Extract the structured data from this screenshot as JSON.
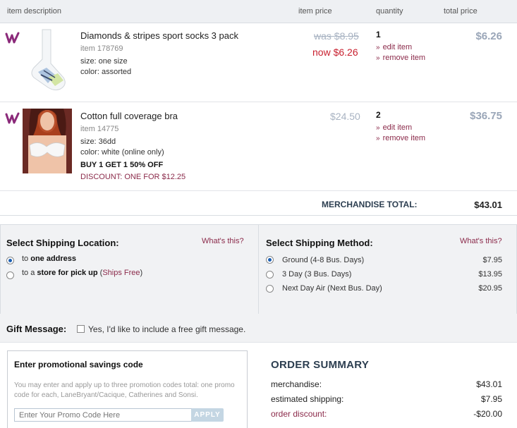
{
  "table_header": {
    "description": "item description",
    "price": "item price",
    "quantity": "quantity",
    "total": "total price"
  },
  "items": [
    {
      "name": "Diamonds & stripes sport socks 3 pack",
      "item_no": "item 178769",
      "size": "size: one size",
      "color": "color: assorted",
      "was": "was $8.95",
      "now": "now $6.26",
      "qty": "1",
      "edit": "edit item",
      "remove": "remove item",
      "total": "$6.26"
    },
    {
      "name": "Cotton full coverage bra",
      "item_no": "item 14775",
      "size": "size: 36dd",
      "color": "color: white (online only)",
      "offer": "BUY 1 GET 1 50% OFF",
      "discount": "DISCOUNT: ONE FOR $12.25",
      "price": "$24.50",
      "qty": "2",
      "edit": "edit item",
      "remove": "remove item",
      "total": "$36.75"
    }
  ],
  "merchandise_total": {
    "label": "MERCHANDISE TOTAL:",
    "value": "$43.01"
  },
  "shipping_location": {
    "title": "Select Shipping Location:",
    "whats_this": "What's this?",
    "opt1_prefix": "to ",
    "opt1_bold": "one address",
    "opt2_prefix": "to a ",
    "opt2_bold": "store for pick up",
    "opt2_paren_open": " (",
    "opt2_link": "Ships Free",
    "opt2_paren_close": ")"
  },
  "shipping_method": {
    "title": "Select Shipping Method:",
    "whats_this": "What's this?",
    "options": [
      {
        "label": "Ground (4-8 Bus. Days)",
        "price": "$7.95"
      },
      {
        "label": "3 Day (3 Bus. Days)",
        "price": "$13.95"
      },
      {
        "label": "Next Day Air (Next Bus. Day)",
        "price": "$20.95"
      }
    ]
  },
  "gift": {
    "label": "Gift Message:",
    "checkbox_text": "Yes, I'd like to include a free gift message."
  },
  "promo": {
    "title": "Enter promotional savings code",
    "description": "You may enter and apply up to three promotion codes total: one promo code for each, LaneBryant/Cacique, Catherines and Sonsi.",
    "placeholder": "Enter Your Promo Code Here",
    "apply": "APPLY"
  },
  "order_summary": {
    "title": "ORDER SUMMARY",
    "rows": [
      {
        "label": "merchandise:",
        "value": "$43.01"
      },
      {
        "label": "estimated shipping:",
        "value": "$7.95"
      },
      {
        "label": "order discount:",
        "value": "-$20.00"
      }
    ]
  },
  "colors": {
    "accent_maroon": "#8b2a4a",
    "sale_red": "#c8202f",
    "muted_price": "#a8b3c2",
    "panel_bg": "#f1f2f4",
    "heading_navy": "#2c3e50"
  }
}
